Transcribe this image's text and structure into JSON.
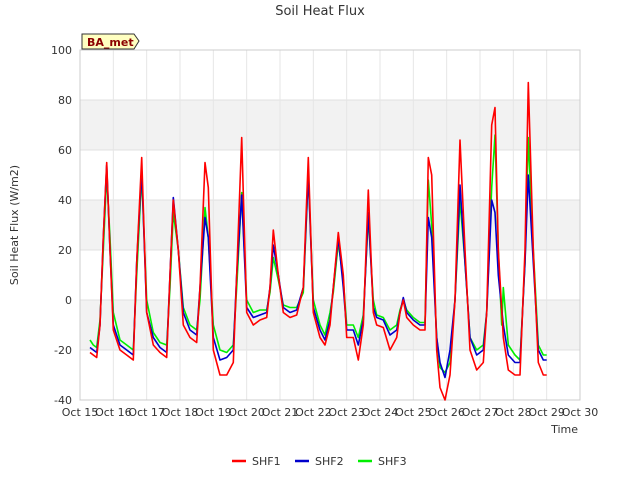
{
  "chart_data": {
    "type": "line",
    "title": "Soil Heat Flux",
    "xlabel": "Time",
    "ylabel": "Soil Heat Flux (W/m2)",
    "badge": "BA_met",
    "ylim": [
      -40,
      100
    ],
    "yticks": [
      -40,
      -20,
      0,
      20,
      40,
      60,
      80,
      100
    ],
    "xlim": [
      15,
      30
    ],
    "xticks": [
      {
        "x": 15,
        "label": "Oct 15"
      },
      {
        "x": 16,
        "label": "Oct 16"
      },
      {
        "x": 17,
        "label": "Oct 17"
      },
      {
        "x": 18,
        "label": "Oct 18"
      },
      {
        "x": 19,
        "label": "Oct 19"
      },
      {
        "x": 20,
        "label": "Oct 20"
      },
      {
        "x": 21,
        "label": "Oct 21"
      },
      {
        "x": 22,
        "label": "Oct 22"
      },
      {
        "x": 23,
        "label": "Oct 23"
      },
      {
        "x": 24,
        "label": "Oct 24"
      },
      {
        "x": 25,
        "label": "Oct 25"
      },
      {
        "x": 26,
        "label": "Oct 26"
      },
      {
        "x": 27,
        "label": "Oct 27"
      },
      {
        "x": 28,
        "label": "Oct 28"
      },
      {
        "x": 29,
        "label": "Oct 29"
      },
      {
        "x": 30,
        "label": "Oct 30"
      }
    ],
    "series": [
      {
        "name": "SHF1",
        "color": "#ff0000",
        "points": [
          [
            15.3,
            -21
          ],
          [
            15.4,
            -22
          ],
          [
            15.5,
            -23
          ],
          [
            15.6,
            -10
          ],
          [
            15.7,
            25
          ],
          [
            15.8,
            55
          ],
          [
            15.9,
            20
          ],
          [
            16.0,
            -12
          ],
          [
            16.2,
            -20
          ],
          [
            16.4,
            -22
          ],
          [
            16.6,
            -24
          ],
          [
            16.7,
            15
          ],
          [
            16.85,
            57
          ],
          [
            17.0,
            -5
          ],
          [
            17.2,
            -18
          ],
          [
            17.4,
            -21
          ],
          [
            17.6,
            -23
          ],
          [
            17.7,
            10
          ],
          [
            17.8,
            40
          ],
          [
            17.95,
            20
          ],
          [
            18.1,
            -10
          ],
          [
            18.3,
            -15
          ],
          [
            18.5,
            -17
          ],
          [
            18.6,
            5
          ],
          [
            18.75,
            55
          ],
          [
            18.85,
            45
          ],
          [
            19.0,
            -20
          ],
          [
            19.2,
            -30
          ],
          [
            19.4,
            -30
          ],
          [
            19.6,
            -25
          ],
          [
            19.7,
            10
          ],
          [
            19.85,
            65
          ],
          [
            20.0,
            -5
          ],
          [
            20.2,
            -10
          ],
          [
            20.4,
            -8
          ],
          [
            20.6,
            -7
          ],
          [
            20.7,
            5
          ],
          [
            20.8,
            28
          ],
          [
            20.95,
            10
          ],
          [
            21.1,
            -5
          ],
          [
            21.3,
            -7
          ],
          [
            21.5,
            -6
          ],
          [
            21.7,
            5
          ],
          [
            21.85,
            57
          ],
          [
            22.0,
            -5
          ],
          [
            22.2,
            -15
          ],
          [
            22.35,
            -18
          ],
          [
            22.5,
            -10
          ],
          [
            22.6,
            5
          ],
          [
            22.75,
            27
          ],
          [
            22.9,
            10
          ],
          [
            23.0,
            -15
          ],
          [
            23.2,
            -15
          ],
          [
            23.35,
            -24
          ],
          [
            23.5,
            -10
          ],
          [
            23.65,
            44
          ],
          [
            23.8,
            -5
          ],
          [
            23.9,
            -10
          ],
          [
            24.1,
            -11
          ],
          [
            24.3,
            -20
          ],
          [
            24.5,
            -15
          ],
          [
            24.6,
            -5
          ],
          [
            24.7,
            0
          ],
          [
            24.8,
            -7
          ],
          [
            25.0,
            -10
          ],
          [
            25.2,
            -12
          ],
          [
            25.35,
            -12
          ],
          [
            25.45,
            57
          ],
          [
            25.55,
            50
          ],
          [
            25.7,
            -20
          ],
          [
            25.8,
            -35
          ],
          [
            25.95,
            -40
          ],
          [
            26.1,
            -30
          ],
          [
            26.25,
            0
          ],
          [
            26.4,
            64
          ],
          [
            26.55,
            20
          ],
          [
            26.7,
            -20
          ],
          [
            26.9,
            -28
          ],
          [
            27.1,
            -25
          ],
          [
            27.2,
            -5
          ],
          [
            27.35,
            70
          ],
          [
            27.45,
            77
          ],
          [
            27.55,
            20
          ],
          [
            27.7,
            -15
          ],
          [
            27.85,
            -28
          ],
          [
            28.05,
            -30
          ],
          [
            28.2,
            -30
          ],
          [
            28.35,
            20
          ],
          [
            28.45,
            87
          ],
          [
            28.6,
            20
          ],
          [
            28.75,
            -25
          ],
          [
            28.9,
            -30
          ],
          [
            29.0,
            -30
          ]
        ]
      },
      {
        "name": "SHF2",
        "color": "#0000cc",
        "points": [
          [
            15.3,
            -19
          ],
          [
            15.4,
            -20
          ],
          [
            15.5,
            -21
          ],
          [
            15.6,
            -10
          ],
          [
            15.7,
            25
          ],
          [
            15.8,
            54
          ],
          [
            15.9,
            20
          ],
          [
            16.0,
            -10
          ],
          [
            16.2,
            -18
          ],
          [
            16.4,
            -20
          ],
          [
            16.6,
            -22
          ],
          [
            16.7,
            15
          ],
          [
            16.85,
            52
          ],
          [
            17.0,
            -5
          ],
          [
            17.2,
            -15
          ],
          [
            17.4,
            -19
          ],
          [
            17.6,
            -21
          ],
          [
            17.7,
            10
          ],
          [
            17.8,
            41
          ],
          [
            17.95,
            20
          ],
          [
            18.1,
            -5
          ],
          [
            18.3,
            -12
          ],
          [
            18.5,
            -14
          ],
          [
            18.6,
            5
          ],
          [
            18.75,
            33
          ],
          [
            18.85,
            25
          ],
          [
            19.0,
            -15
          ],
          [
            19.2,
            -24
          ],
          [
            19.4,
            -23
          ],
          [
            19.6,
            -20
          ],
          [
            19.7,
            10
          ],
          [
            19.85,
            42
          ],
          [
            20.0,
            -3
          ],
          [
            20.2,
            -7
          ],
          [
            20.4,
            -6
          ],
          [
            20.6,
            -5
          ],
          [
            20.7,
            5
          ],
          [
            20.8,
            22
          ],
          [
            20.95,
            10
          ],
          [
            21.1,
            -3
          ],
          [
            21.3,
            -5
          ],
          [
            21.5,
            -4
          ],
          [
            21.7,
            5
          ],
          [
            21.85,
            50
          ],
          [
            22.0,
            -3
          ],
          [
            22.2,
            -12
          ],
          [
            22.35,
            -16
          ],
          [
            22.5,
            -8
          ],
          [
            22.6,
            5
          ],
          [
            22.75,
            25
          ],
          [
            22.9,
            5
          ],
          [
            23.0,
            -12
          ],
          [
            23.2,
            -12
          ],
          [
            23.35,
            -18
          ],
          [
            23.5,
            -8
          ],
          [
            23.65,
            35
          ],
          [
            23.8,
            -3
          ],
          [
            23.9,
            -7
          ],
          [
            24.1,
            -8
          ],
          [
            24.3,
            -14
          ],
          [
            24.5,
            -12
          ],
          [
            24.6,
            -5
          ],
          [
            24.7,
            1
          ],
          [
            24.8,
            -5
          ],
          [
            25.0,
            -8
          ],
          [
            25.2,
            -10
          ],
          [
            25.35,
            -10
          ],
          [
            25.45,
            33
          ],
          [
            25.55,
            25
          ],
          [
            25.7,
            -15
          ],
          [
            25.8,
            -25
          ],
          [
            25.95,
            -31
          ],
          [
            26.1,
            -20
          ],
          [
            26.25,
            0
          ],
          [
            26.4,
            46
          ],
          [
            26.55,
            15
          ],
          [
            26.7,
            -15
          ],
          [
            26.9,
            -22
          ],
          [
            27.1,
            -20
          ],
          [
            27.2,
            -5
          ],
          [
            27.35,
            40
          ],
          [
            27.45,
            35
          ],
          [
            27.55,
            10
          ],
          [
            27.7,
            -10
          ],
          [
            27.85,
            -22
          ],
          [
            28.05,
            -25
          ],
          [
            28.2,
            -25
          ],
          [
            28.35,
            15
          ],
          [
            28.45,
            50
          ],
          [
            28.6,
            15
          ],
          [
            28.75,
            -20
          ],
          [
            28.9,
            -24
          ],
          [
            29.0,
            -24
          ]
        ]
      },
      {
        "name": "SHF3",
        "color": "#00ee00",
        "points": [
          [
            15.3,
            -16
          ],
          [
            15.4,
            -18
          ],
          [
            15.5,
            -19
          ],
          [
            15.6,
            -8
          ],
          [
            15.7,
            20
          ],
          [
            15.8,
            50
          ],
          [
            15.9,
            25
          ],
          [
            16.0,
            -5
          ],
          [
            16.2,
            -16
          ],
          [
            16.4,
            -18
          ],
          [
            16.6,
            -20
          ],
          [
            16.7,
            10
          ],
          [
            16.85,
            50
          ],
          [
            17.0,
            0
          ],
          [
            17.2,
            -13
          ],
          [
            17.4,
            -17
          ],
          [
            17.6,
            -18
          ],
          [
            17.7,
            5
          ],
          [
            17.8,
            35
          ],
          [
            17.95,
            20
          ],
          [
            18.1,
            -3
          ],
          [
            18.3,
            -10
          ],
          [
            18.5,
            -12
          ],
          [
            18.6,
            0
          ],
          [
            18.75,
            37
          ],
          [
            18.85,
            25
          ],
          [
            19.0,
            -10
          ],
          [
            19.2,
            -20
          ],
          [
            19.4,
            -21
          ],
          [
            19.6,
            -18
          ],
          [
            19.7,
            5
          ],
          [
            19.85,
            43
          ],
          [
            20.0,
            0
          ],
          [
            20.2,
            -5
          ],
          [
            20.4,
            -4
          ],
          [
            20.6,
            -4
          ],
          [
            20.7,
            3
          ],
          [
            20.8,
            17
          ],
          [
            20.95,
            8
          ],
          [
            21.1,
            -2
          ],
          [
            21.3,
            -3
          ],
          [
            21.5,
            -3
          ],
          [
            21.7,
            3
          ],
          [
            21.85,
            50
          ],
          [
            22.0,
            0
          ],
          [
            22.2,
            -10
          ],
          [
            22.35,
            -14
          ],
          [
            22.5,
            -5
          ],
          [
            22.6,
            3
          ],
          [
            22.75,
            23
          ],
          [
            22.9,
            8
          ],
          [
            23.0,
            -10
          ],
          [
            23.2,
            -10
          ],
          [
            23.35,
            -15
          ],
          [
            23.5,
            -6
          ],
          [
            23.65,
            33
          ],
          [
            23.8,
            0
          ],
          [
            23.9,
            -6
          ],
          [
            24.1,
            -7
          ],
          [
            24.3,
            -12
          ],
          [
            24.5,
            -10
          ],
          [
            24.6,
            -4
          ],
          [
            24.7,
            0
          ],
          [
            24.8,
            -4
          ],
          [
            25.0,
            -7
          ],
          [
            25.2,
            -9
          ],
          [
            25.35,
            -9
          ],
          [
            25.45,
            48
          ],
          [
            25.55,
            30
          ],
          [
            25.7,
            -15
          ],
          [
            25.8,
            -27
          ],
          [
            25.95,
            -29
          ],
          [
            26.1,
            -25
          ],
          [
            26.25,
            0
          ],
          [
            26.4,
            40
          ],
          [
            26.55,
            15
          ],
          [
            26.7,
            -15
          ],
          [
            26.9,
            -20
          ],
          [
            27.1,
            -18
          ],
          [
            27.2,
            -5
          ],
          [
            27.35,
            45
          ],
          [
            27.45,
            66
          ],
          [
            27.55,
            20
          ],
          [
            27.65,
            -10
          ],
          [
            27.7,
            5
          ],
          [
            27.85,
            -18
          ],
          [
            28.05,
            -22
          ],
          [
            28.2,
            -24
          ],
          [
            28.35,
            15
          ],
          [
            28.45,
            65
          ],
          [
            28.6,
            20
          ],
          [
            28.75,
            -18
          ],
          [
            28.9,
            -22
          ],
          [
            29.0,
            -22
          ]
        ]
      }
    ],
    "grid": true,
    "legend": "bottom-center"
  }
}
